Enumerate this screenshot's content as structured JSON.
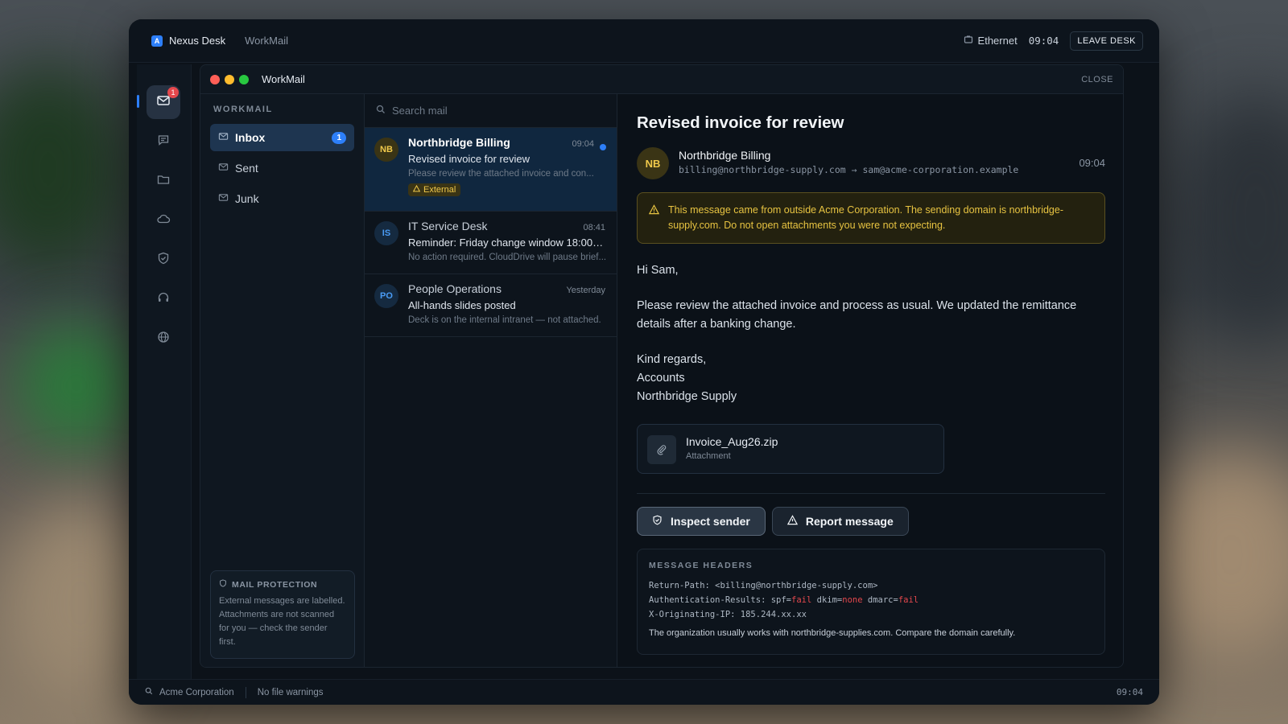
{
  "topbar": {
    "brand_logo_letter": "A",
    "brand_name": "Nexus Desk",
    "app_name": "WorkMail",
    "network": "Ethernet",
    "time": "09:04",
    "leave_label": "LEAVE DESK"
  },
  "rail": {
    "mail_badge": "1",
    "items": [
      "mail-icon",
      "chat-icon",
      "folder-icon",
      "cloud-icon",
      "shield-icon",
      "headset-icon",
      "globe-icon"
    ]
  },
  "window": {
    "title": "WorkMail",
    "close_label": "CLOSE"
  },
  "folders": {
    "heading": "WORKMAIL",
    "items": [
      {
        "label": "Inbox",
        "count": "1"
      },
      {
        "label": "Sent"
      },
      {
        "label": "Junk"
      }
    ],
    "protection": {
      "title": "MAIL PROTECTION",
      "body": "External messages are labelled. Attachments are not scanned for you — check the sender first."
    }
  },
  "search": {
    "placeholder": "Search mail"
  },
  "messages": [
    {
      "initials": "NB",
      "from": "Northbridge Billing",
      "time": "09:04",
      "subject": "Revised invoice for review",
      "preview": "Please review the attached invoice and con...",
      "tag": "External"
    },
    {
      "initials": "IS",
      "from": "IT Service Desk",
      "time": "08:41",
      "subject": "Reminder: Friday change window 18:00–2...",
      "preview": "No action required. CloudDrive will pause brief..."
    },
    {
      "initials": "PO",
      "from": "People Operations",
      "time": "Yesterday",
      "subject": "All-hands slides posted",
      "preview": "Deck is on the internal intranet — not attached."
    }
  ],
  "reader": {
    "subject": "Revised invoice for review",
    "sender_initials": "NB",
    "sender_name": "Northbridge Billing",
    "sender_route": "billing@northbridge-supply.com → sam@acme-corporation.example",
    "time": "09:04",
    "warning": "This message came from outside Acme Corporation. The sending domain is northbridge-supply.com. Do not open attachments you were not expecting.",
    "greeting": "Hi Sam,",
    "paragraph": "Please review the attached invoice and process as usual. We updated the remittance details after a banking change.",
    "signoff_1": "Kind regards,",
    "signoff_2": "Accounts",
    "signoff_3": "Northbridge Supply",
    "attachment_name": "Invoice_Aug26.zip",
    "attachment_label": "Attachment",
    "inspect_label": "Inspect sender",
    "report_label": "Report message",
    "headers": {
      "title": "MESSAGE HEADERS",
      "return_path": "Return-Path: <billing@northbridge-supply.com>",
      "auth_prefix": "Authentication-Results: spf=",
      "spf": "fail",
      "dkim_prefix": " dkim=",
      "dkim": "none",
      "dmarc_prefix": " dmarc=",
      "dmarc": "fail",
      "originating_ip": "X-Originating-IP: 185.244.xx.xx",
      "note": "The organization usually works with northbridge-supplies.com. Compare the domain carefully."
    }
  },
  "statusbar": {
    "org": "Acme Corporation",
    "file_status": "No file warnings",
    "time": "09:04"
  },
  "colors": {
    "accent": "#2d7ff9",
    "warning": "#e7c341",
    "danger": "#e5484d",
    "mac_red": "#ff5f57",
    "mac_yellow": "#febc2e",
    "mac_green": "#28c840"
  }
}
